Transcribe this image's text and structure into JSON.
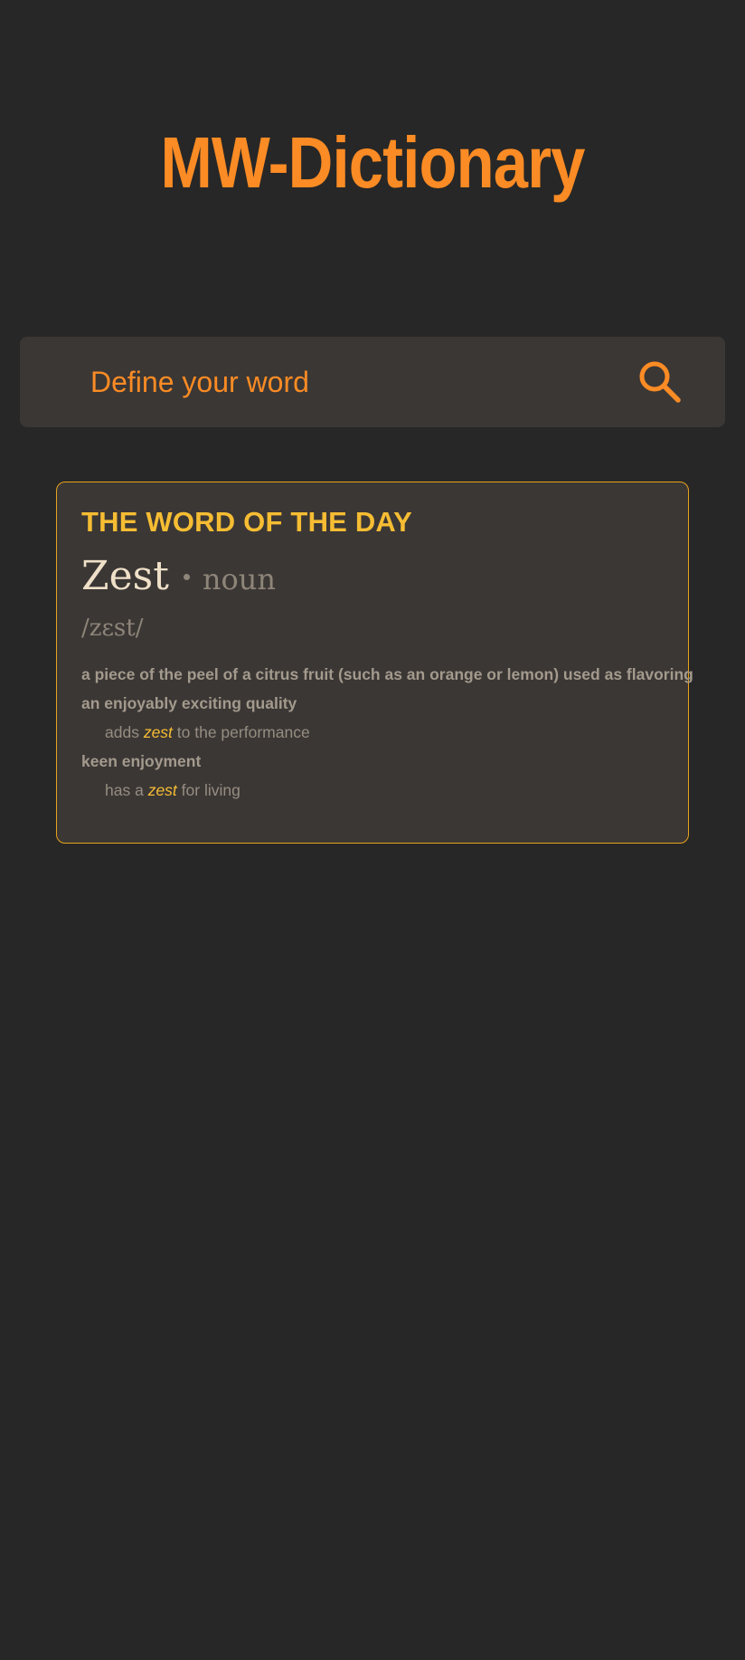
{
  "header": {
    "title": "MW-Dictionary"
  },
  "search": {
    "placeholder": "Define your word",
    "value": "",
    "icon": "search-icon"
  },
  "word_of_the_day": {
    "heading": "THE WORD OF THE DAY",
    "word": "Zest",
    "part_of_speech": "noun",
    "pronunciation": "/zɛst/",
    "definitions": [
      {
        "text": "a piece of the peel of a citrus fruit (such as an orange or lemon) used as flavoring",
        "example": null
      },
      {
        "text": "an enjoyably exciting quality",
        "example": {
          "before": "adds ",
          "highlight": "zest",
          "after": " to the performance"
        }
      },
      {
        "text": "keen enjoyment",
        "example": {
          "before": "has a ",
          "highlight": "zest",
          "after": " for living"
        }
      }
    ]
  },
  "colors": {
    "background": "#272727",
    "surface": "#3b3735",
    "accent": "#fb8b24",
    "highlight": "#f6bd33",
    "muted": "#8e8579"
  }
}
